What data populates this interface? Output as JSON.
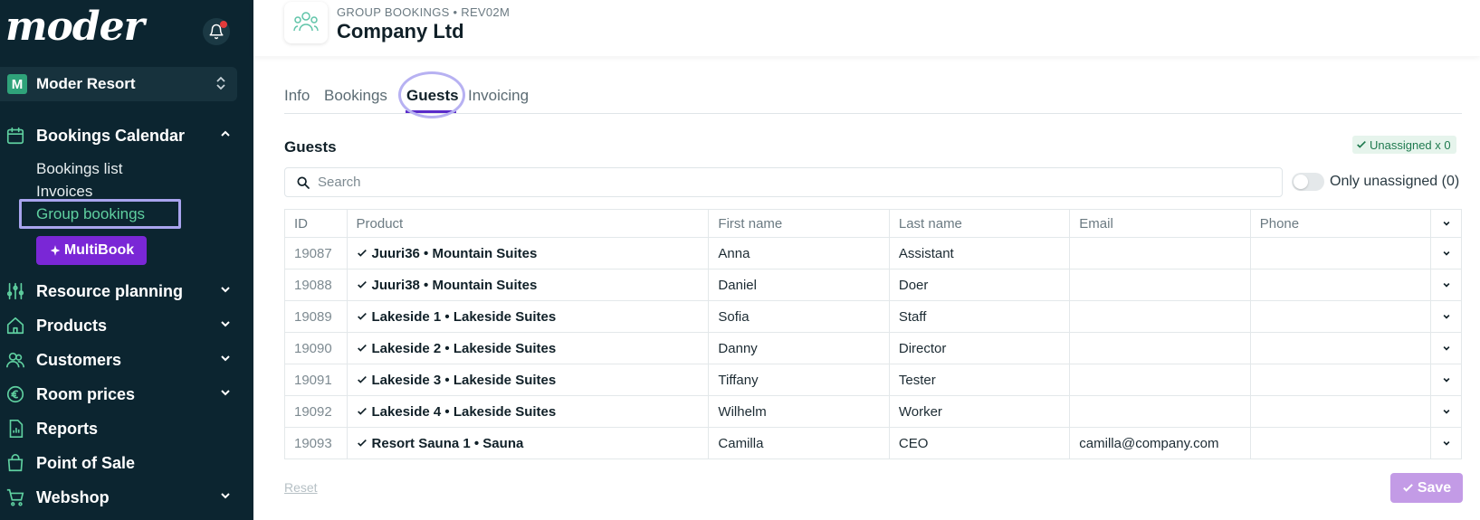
{
  "app": {
    "logo": "moder"
  },
  "sidebar": {
    "resort": {
      "badge": "M",
      "name": "Moder Resort"
    },
    "nav": {
      "bookings_calendar": "Bookings Calendar",
      "sub": {
        "bookings_list": "Bookings list",
        "invoices": "Invoices",
        "group_bookings": "Group bookings"
      },
      "multibook": "MultiBook",
      "resource_planning": "Resource planning",
      "products": "Products",
      "customers": "Customers",
      "room_prices": "Room prices",
      "reports": "Reports",
      "point_of_sale": "Point of Sale",
      "webshop": "Webshop"
    }
  },
  "header": {
    "breadcrumb": "GROUP BOOKINGS • REV02M",
    "title": "Company Ltd"
  },
  "tabs": {
    "info": "Info",
    "bookings": "Bookings",
    "guests": "Guests",
    "invoicing": "Invoicing"
  },
  "guests": {
    "title": "Guests",
    "unassigned_badge": "Unassigned x 0",
    "search_placeholder": "Search",
    "only_unassigned": "Only unassigned (0)",
    "columns": {
      "id": "ID",
      "product": "Product",
      "first_name": "First name",
      "last_name": "Last name",
      "email": "Email",
      "phone": "Phone"
    },
    "rows": [
      {
        "id": "19087",
        "product": "Juuri36 • Mountain Suites",
        "first": "Anna",
        "last": "Assistant",
        "email": "",
        "phone": ""
      },
      {
        "id": "19088",
        "product": "Juuri38 • Mountain Suites",
        "first": "Daniel",
        "last": "Doer",
        "email": "",
        "phone": ""
      },
      {
        "id": "19089",
        "product": "Lakeside 1 • Lakeside Suites",
        "first": "Sofia",
        "last": "Staff",
        "email": "",
        "phone": ""
      },
      {
        "id": "19090",
        "product": "Lakeside 2 • Lakeside Suites",
        "first": "Danny",
        "last": "Director",
        "email": "",
        "phone": ""
      },
      {
        "id": "19091",
        "product": "Lakeside 3 • Lakeside Suites",
        "first": "Tiffany",
        "last": "Tester",
        "email": "",
        "phone": ""
      },
      {
        "id": "19092",
        "product": "Lakeside 4 • Lakeside Suites",
        "first": "Wilhelm",
        "last": "Worker",
        "email": "",
        "phone": ""
      },
      {
        "id": "19093",
        "product": "Resort Sauna 1 • Sauna",
        "first": "Camilla",
        "last": "CEO",
        "email": "camilla@company.com",
        "phone": ""
      }
    ]
  },
  "footer": {
    "reset": "Reset",
    "save": "Save"
  },
  "colors": {
    "sidebar_bg": "#0c2530",
    "accent_green": "#5fd0a0",
    "accent_purple": "#7a27d6",
    "save_bg": "#c39be6",
    "tab_underline": "#5a2bc9"
  },
  "icons": [
    "bell-icon",
    "calendar-icon",
    "sliders-icon",
    "home-icon",
    "users-icon",
    "euro-icon",
    "report-icon",
    "bag-icon",
    "cart-icon",
    "search-icon",
    "check-icon",
    "chevron-down-icon",
    "group-icon"
  ]
}
